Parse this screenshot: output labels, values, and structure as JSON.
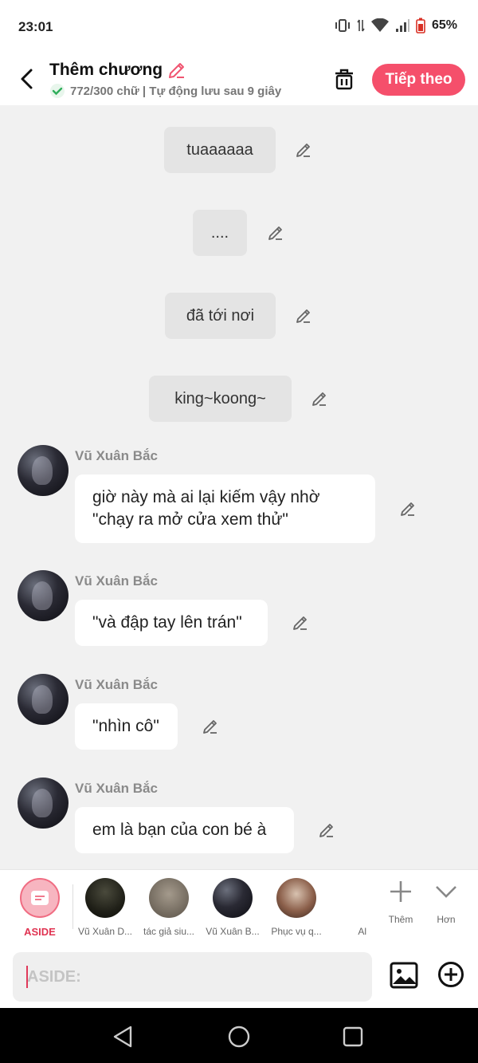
{
  "status": {
    "time": "23:01",
    "battery": "65%"
  },
  "header": {
    "title": "Thêm chương",
    "subtitle": "772/300 chữ | Tự động lưu sau 9 giây",
    "next_label": "Tiếp theo"
  },
  "chat": {
    "narrations": [
      {
        "text": "tuaaaaaa"
      },
      {
        "text": "...."
      },
      {
        "text": "đã tới nơi"
      },
      {
        "text": "king~koong~"
      }
    ],
    "messages": [
      {
        "sender": "Vũ Xuân Bắc",
        "lines": [
          "giờ này mà ai lại kiếm vậy nhờ",
          "\"chạy ra mở cửa xem thử\""
        ]
      },
      {
        "sender": "Vũ Xuân Bắc",
        "lines": [
          "\"và đập tay lên trán\""
        ]
      },
      {
        "sender": "Vũ Xuân Bắc",
        "lines": [
          "\"nhìn cô\""
        ]
      },
      {
        "sender": "Vũ Xuân Bắc",
        "lines": [
          "em là bạn của con bé à"
        ]
      }
    ]
  },
  "characters": {
    "aside_label": "ASIDE",
    "items": [
      {
        "label": "Vũ Xuân D..."
      },
      {
        "label": "tác giả siu..."
      },
      {
        "label": "Vũ Xuân B..."
      },
      {
        "label": "Phục vụ q..."
      },
      {
        "label": "Al"
      }
    ],
    "add_label": "Thêm",
    "more_label": "Hơn"
  },
  "composer": {
    "placeholder": "ASIDE:"
  }
}
